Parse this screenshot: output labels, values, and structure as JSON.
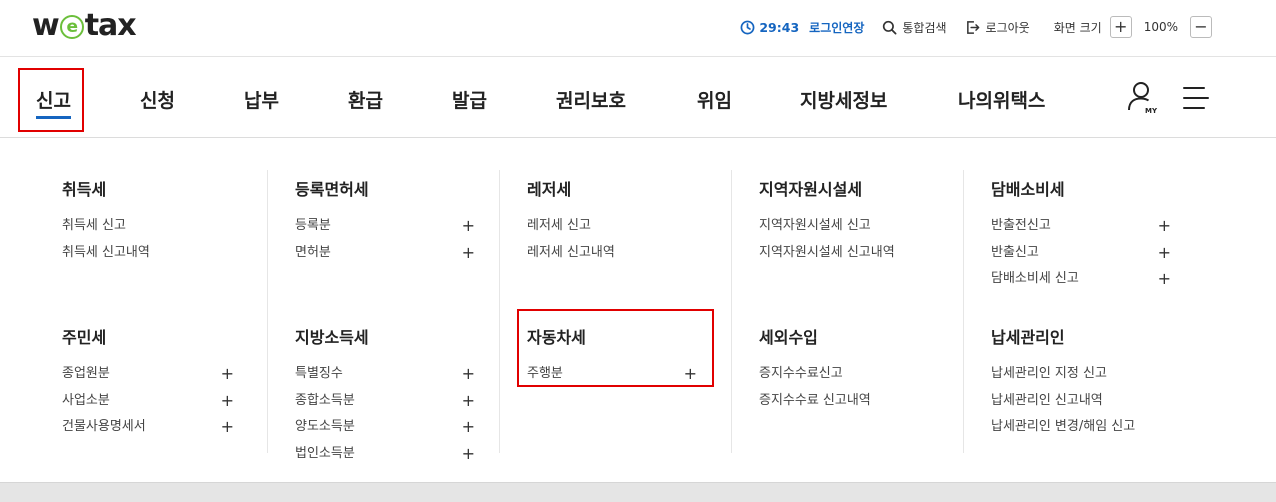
{
  "logo": {
    "pre": "w",
    "mark": "e",
    "post": "tax"
  },
  "util": {
    "timer": "29:43",
    "extend": "로그인연장",
    "search": "통합검색",
    "logout": "로그아웃",
    "screen_size": "화면 크기",
    "plus": "+",
    "zoom": "100%",
    "minus": "−"
  },
  "gnb": {
    "items": [
      "신고",
      "신청",
      "납부",
      "환급",
      "발급",
      "권리보호",
      "위임",
      "지방세정보",
      "나의위택스"
    ],
    "my_label": "MY"
  },
  "mega": {
    "groups": [
      {
        "title": "취득세",
        "items": [
          {
            "label": "취득세 신고",
            "plus": ""
          },
          {
            "label": "취득세 신고내역",
            "plus": ""
          }
        ]
      },
      {
        "title": "등록면허세",
        "items": [
          {
            "label": "등록분",
            "plus": "+"
          },
          {
            "label": "면허분",
            "plus": "+"
          }
        ]
      },
      {
        "title": "레저세",
        "items": [
          {
            "label": "레저세 신고",
            "plus": ""
          },
          {
            "label": "레저세 신고내역",
            "plus": ""
          }
        ]
      },
      {
        "title": "지역자원시설세",
        "items": [
          {
            "label": "지역자원시설세 신고",
            "plus": ""
          },
          {
            "label": "지역자원시설세 신고내역",
            "plus": ""
          }
        ]
      },
      {
        "title": "담배소비세",
        "items": [
          {
            "label": "반출전신고",
            "plus": "+"
          },
          {
            "label": "반출신고",
            "plus": "+"
          },
          {
            "label": "담배소비세 신고",
            "plus": "+"
          }
        ]
      },
      {
        "title": "주민세",
        "items": [
          {
            "label": "종업원분",
            "plus": "+"
          },
          {
            "label": "사업소분",
            "plus": "+"
          },
          {
            "label": "건물사용명세서",
            "plus": "+"
          }
        ]
      },
      {
        "title": "지방소득세",
        "items": [
          {
            "label": "특별징수",
            "plus": "+"
          },
          {
            "label": "종합소득분",
            "plus": "+"
          },
          {
            "label": "양도소득분",
            "plus": "+"
          },
          {
            "label": "법인소득분",
            "plus": "+"
          }
        ]
      },
      {
        "title": "자동차세",
        "items": [
          {
            "label": "주행분",
            "plus": "+"
          }
        ]
      },
      {
        "title": "세외수입",
        "items": [
          {
            "label": "증지수수료신고",
            "plus": ""
          },
          {
            "label": "증지수수료 신고내역",
            "plus": ""
          }
        ]
      },
      {
        "title": "납세관리인",
        "items": [
          {
            "label": "납세관리인 지정 신고",
            "plus": ""
          },
          {
            "label": "납세관리인 신고내역",
            "plus": ""
          },
          {
            "label": "납세관리인 변경/해임 신고",
            "plus": ""
          }
        ]
      }
    ]
  }
}
